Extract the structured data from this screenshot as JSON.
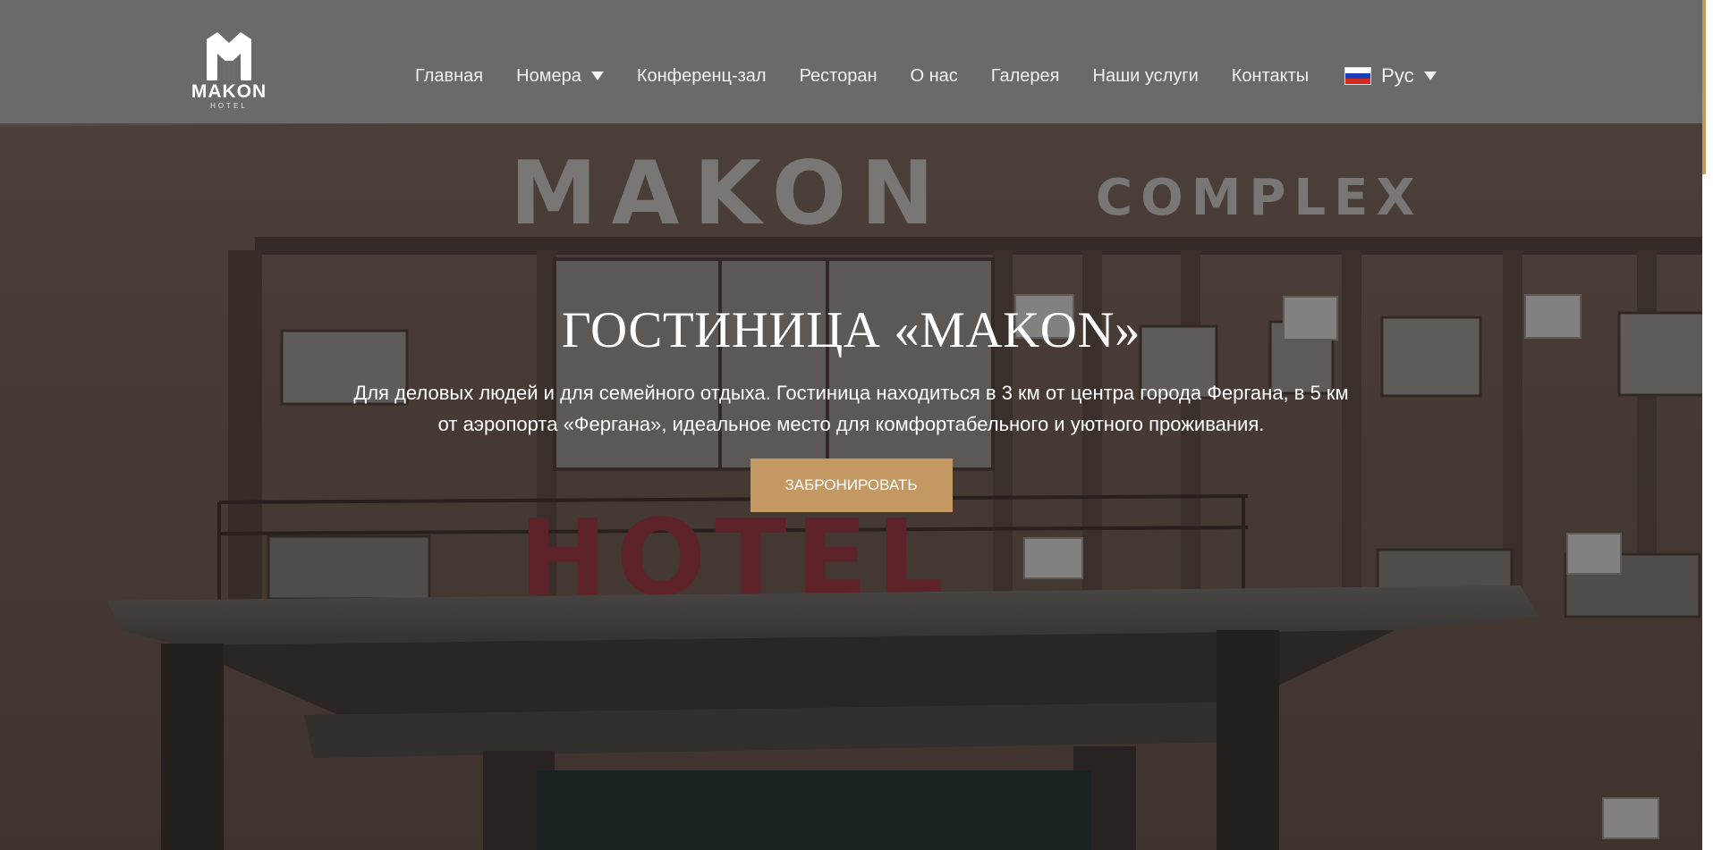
{
  "header": {
    "logo": {
      "word": "MAKON",
      "sub": "HOTEL",
      "icon": "makon-logo-icon"
    },
    "nav": [
      {
        "label": "Главная"
      },
      {
        "label": "Номера",
        "dropdown": true
      },
      {
        "label": "Конференц-зал"
      },
      {
        "label": "Ресторан"
      },
      {
        "label": "О нас"
      },
      {
        "label": "Галерея"
      },
      {
        "label": "Наши услуги"
      },
      {
        "label": "Контакты"
      }
    ],
    "language": {
      "label": "Рус",
      "flag_icon": "russia-flag-icon"
    }
  },
  "hero": {
    "title": "ГОСТИНИЦА «MAKON»",
    "description": "Для деловых людей и для семейного отдыха. Гостиница находиться в 3 км от центра города Фергана, в 5 км от аэропорта «Фергана», идеальное место для комфортабельного и уютного проживания.",
    "button_label": "ЗАБРОНИРОВАТЬ"
  },
  "background_signage": {
    "main": "MAKON",
    "secondary": "COMPLEX",
    "lower": "HOTEL"
  },
  "colors": {
    "accent": "#c49863",
    "header_bg": "#6e6e6e",
    "text": "#ffffff"
  }
}
